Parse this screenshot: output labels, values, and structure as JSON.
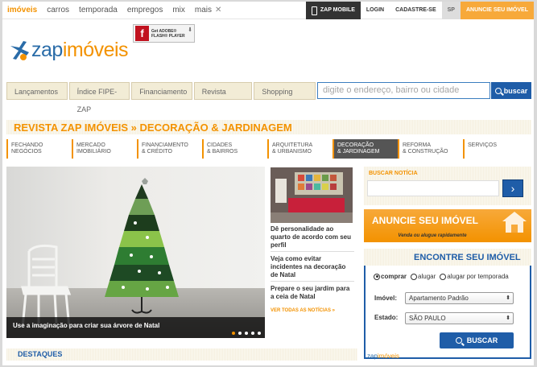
{
  "topnav": {
    "items": [
      "imóveis",
      "carros",
      "temporada",
      "empregos",
      "mix",
      "mais"
    ],
    "close_glyph": "✕",
    "links": {
      "mobile": "ZAP MOBILE",
      "login": "LOGIN",
      "cadastre": "CADASTRE-SE",
      "region": "SP",
      "anuncie": "ANUNCIE SEU IMÓVEL"
    }
  },
  "logo": {
    "part1": "zap",
    "part2": "imóveis"
  },
  "flash_badge": {
    "line1": "Get ADOBE®",
    "line2": "FLASH® PLAYER",
    "icon": "f"
  },
  "mainnav": [
    "Lançamentos",
    "Índice FIPE-ZAP",
    "Financiamento",
    "Revista",
    "Shopping"
  ],
  "search": {
    "placeholder": "digite o endereço, bairro ou cidade",
    "button": "buscar"
  },
  "section": {
    "title": "REVISTA ZAP IMÓVEIS  » DECORAÇÃO & JARDINAGEM",
    "subnav": [
      {
        "l1": "FECHANDO",
        "l2": "NEGÓCIOS"
      },
      {
        "l1": "MERCADO",
        "l2": "IMOBILIÁRIO"
      },
      {
        "l1": "FINANCIAMENTO",
        "l2": "& CRÉDITO"
      },
      {
        "l1": "CIDADES",
        "l2": "& BAIRROS"
      },
      {
        "l1": "ARQUITETURA",
        "l2": "& URBANISMO"
      },
      {
        "l1": "DECORAÇÃO",
        "l2": "& JARDINAGEM"
      },
      {
        "l1": "REFORMA",
        "l2": "& CONSTRUÇÃO"
      },
      {
        "l1": "SERVIÇOS",
        "l2": ""
      }
    ]
  },
  "hero": {
    "caption": "Use a imaginação para criar sua árvore de Natal",
    "slides": 5,
    "active_slide": 1
  },
  "news": [
    "Dê personalidade ao quarto de acordo com seu perfil",
    "Veja como evitar incidentes na decoração de Natal",
    "Prepare o seu jardim para a ceia de Natal"
  ],
  "all_news": "VER TODAS AS NOTÍCIAS »",
  "busca_noticia": {
    "label": "BUSCAR NOTÍCIA",
    "button_icon": "›"
  },
  "anuncie_box": {
    "title": "ANUNCIE SEU IMÓVEL",
    "subtitle": "Venda ou alugue rapidamente"
  },
  "encontre": {
    "title": "ENCONTRE SEU IMÓVEL",
    "radios": [
      "comprar",
      "alugar",
      "alugar por temporada"
    ],
    "imovel_label": "Imóvel:",
    "imovel_value": "Apartamento Padrão",
    "estado_label": "Estado:",
    "estado_value": "SÃO PAULO",
    "button": "BUSCAR"
  },
  "destaques": "DESTAQUES",
  "colors": {
    "orange": "#f39200",
    "blue": "#1f5da8",
    "dark": "#333333"
  }
}
